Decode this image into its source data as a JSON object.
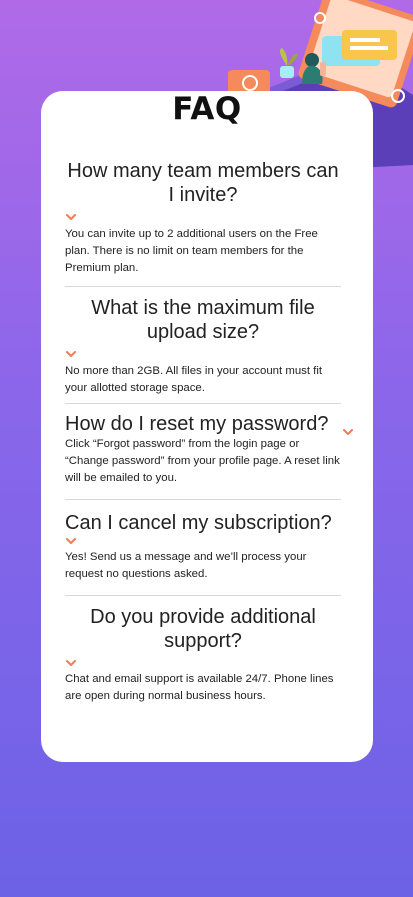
{
  "page": {
    "title": "FAQ"
  },
  "faq": [
    {
      "question": "How many team members can I invite?",
      "answer": "You can invite up to 2 additional users on the Free plan. There is no limit on team members for the Premium plan."
    },
    {
      "question": "What is the maximum file upload size?",
      "answer": "No more than 2GB. All files in your account must fit your allotted storage space."
    },
    {
      "question": "How do I reset my password?",
      "answer": "Click “Forgot password” from the login page or “Change password” from your profile page. A reset link will be emailed to you."
    },
    {
      "question": "Can I cancel my subscription?",
      "answer": "Yes! Send us a message and we’ll process your request no questions asked."
    },
    {
      "question": "Do you provide additional support?",
      "answer": "Chat and email support is available 24/7. Phone lines are open during normal business hours."
    }
  ],
  "icons": {
    "chevron": "chevron-down-icon",
    "illustration": "woman-online-illustration"
  },
  "colors": {
    "accent": "#f47b56",
    "background_top": "#b06ae8",
    "background_bottom": "#6c62e6",
    "card": "#ffffff",
    "divider": "#d8d6e0"
  }
}
